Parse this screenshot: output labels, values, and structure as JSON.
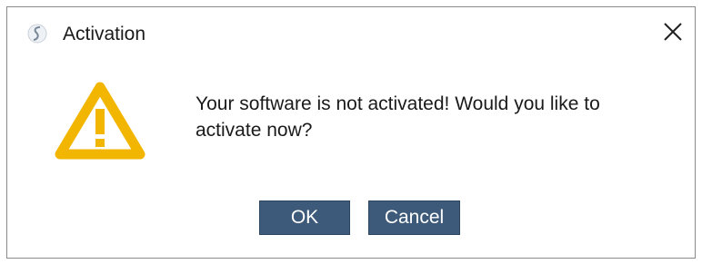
{
  "window": {
    "title": "Activation",
    "app_icon": "app-logo-icon",
    "close_icon": "close-icon"
  },
  "dialog": {
    "icon": "warning-icon",
    "message": "Your software is not activated! Would you like to activate now?"
  },
  "buttons": {
    "ok_label": "OK",
    "cancel_label": "Cancel"
  },
  "colors": {
    "warning": "#f2b600",
    "button_bg": "#3d5a7a",
    "button_text": "#ffffff"
  }
}
